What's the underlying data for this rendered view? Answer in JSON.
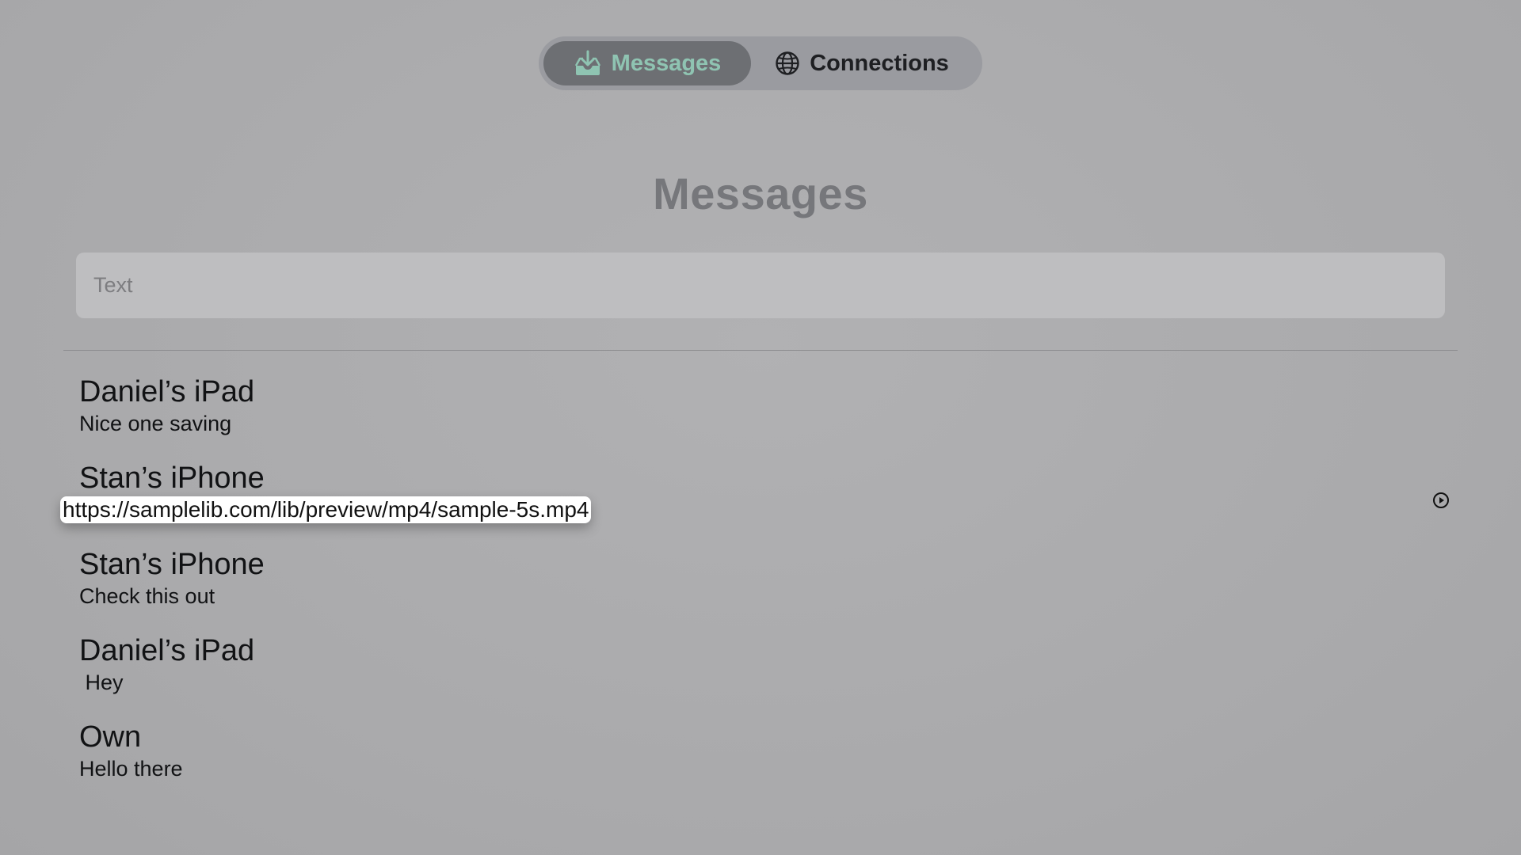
{
  "tabs": [
    {
      "label": "Messages",
      "icon": "tray-download-icon",
      "active": true
    },
    {
      "label": "Connections",
      "icon": "globe-icon",
      "active": false
    }
  ],
  "page": {
    "title": "Messages"
  },
  "input": {
    "placeholder": "Text",
    "value": ""
  },
  "messages": [
    {
      "sender": "Daniel’s iPad",
      "text": "Nice one saving"
    },
    {
      "sender": "Stan’s iPhone",
      "text": "https://samplelib.com/lib/preview/mp4/sample-5s.mp4",
      "is_link": true,
      "has_play": true
    },
    {
      "sender": "Stan’s iPhone",
      "text": "Check this out"
    },
    {
      "sender": "Daniel’s iPad",
      "text": " Hey"
    },
    {
      "sender": "Own",
      "text": "Hello there"
    }
  ],
  "colors": {
    "active_tab_text": "#8fc4b2",
    "active_tab_bg": "#6d6f73",
    "background": "#ababad"
  }
}
